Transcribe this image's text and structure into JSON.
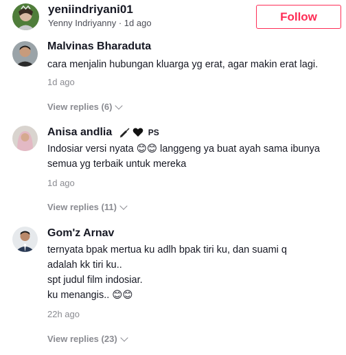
{
  "header": {
    "username": "yeniindriyani01",
    "display_name_time": "Yenny Indriyanny · 1d ago",
    "follow_label": "Follow"
  },
  "comments": [
    {
      "name": "Malvinas Bharaduta",
      "text": "cara menjalin hubungan kluarga yg erat, agar makin erat lagi.",
      "time": "1d ago",
      "replies": "View replies (6)"
    },
    {
      "name": "Anisa andlia",
      "name_suffix": "PS",
      "text": "Indosiar versi nyata 😊😊 langgeng ya buat ayah sama ibunya semua yg terbaik untuk mereka",
      "time": "1d ago",
      "replies": "View replies (11)"
    },
    {
      "name": "Gom'z Arnav",
      "text_lines": [
        "ternyata bpak mertua ku adlh bpak tiri ku, dan suami q",
        "adalah kk tiri ku..",
        "spt judul film indosiar.",
        "ku menangis.. 😊😊"
      ],
      "time": "22h ago",
      "replies": "View replies (23)"
    }
  ],
  "colors": {
    "accent": "#fe2c55",
    "text_primary": "#161823",
    "text_secondary": "#8a8b91"
  }
}
